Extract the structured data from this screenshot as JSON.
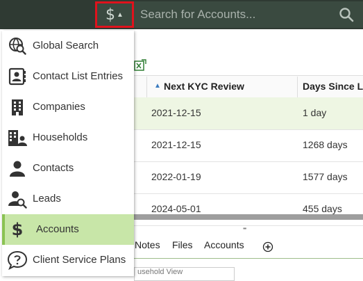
{
  "search": {
    "scope_symbol": "$",
    "placeholder": "Search for Accounts..."
  },
  "menu": {
    "items": [
      {
        "label": "Global Search",
        "icon": "globe-search-icon",
        "active": false
      },
      {
        "label": "Contact List Entries",
        "icon": "contact-card-icon",
        "active": false
      },
      {
        "label": "Companies",
        "icon": "building-icon",
        "active": false
      },
      {
        "label": "Households",
        "icon": "household-icon",
        "active": false
      },
      {
        "label": "Contacts",
        "icon": "person-icon",
        "active": false
      },
      {
        "label": "Leads",
        "icon": "person-search-icon",
        "active": false
      },
      {
        "label": "Accounts",
        "icon": "dollar-icon",
        "active": true
      },
      {
        "label": "Client Service Plans",
        "icon": "chat-question-icon",
        "active": false
      }
    ]
  },
  "grid": {
    "columns": {
      "kyc": "Next KYC Review",
      "days": "Days Since La"
    },
    "rows": [
      {
        "kyc": "2021-12-15",
        "days": "1 day"
      },
      {
        "kyc": "2021-12-15",
        "days": "1268 days"
      },
      {
        "kyc": "2022-01-19",
        "days": "1577 days"
      },
      {
        "kyc": "2024-05-01",
        "days": "455 days"
      }
    ]
  },
  "tabs": [
    "Notes",
    "Files",
    "Accounts"
  ],
  "subview": {
    "label": "usehold View"
  },
  "colors": {
    "topbar": "#2f3a33",
    "highlight_border": "#e0121c",
    "active_item": "#c8e6a8"
  }
}
